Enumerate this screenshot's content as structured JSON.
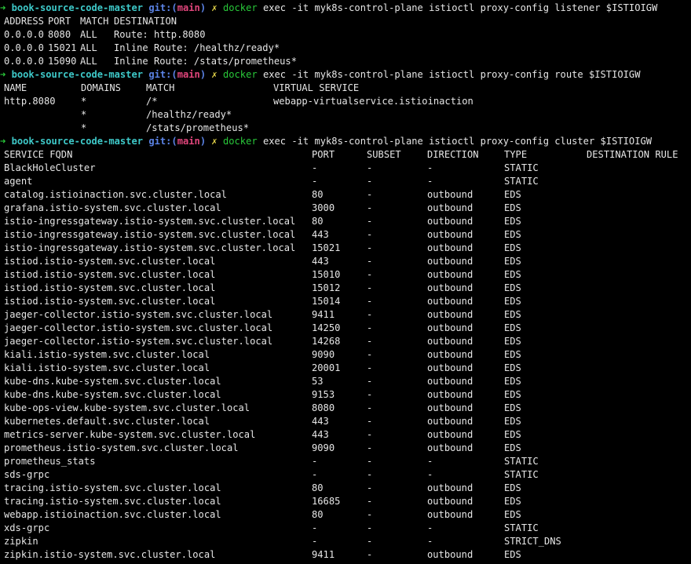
{
  "prompt": {
    "arrow": "➜",
    "dir": "book-source-code-master",
    "git_label": "git:(",
    "branch": "main",
    "git_close": ")",
    "dirty": "✗",
    "cmd": "docker"
  },
  "commands": [
    "exec -it myk8s-control-plane istioctl proxy-config listener $ISTIOIGW",
    "exec -it myk8s-control-plane istioctl proxy-config route $ISTIOIGW",
    "exec -it myk8s-control-plane istioctl proxy-config cluster $ISTIOIGW"
  ],
  "listener": {
    "headers": [
      "ADDRESS",
      "PORT",
      "MATCH",
      "DESTINATION"
    ],
    "rows": [
      [
        "0.0.0.0",
        "8080",
        "ALL",
        "Route: http.8080"
      ],
      [
        "0.0.0.0",
        "15021",
        "ALL",
        "Inline Route: /healthz/ready*"
      ],
      [
        "0.0.0.0",
        "15090",
        "ALL",
        "Inline Route: /stats/prometheus*"
      ]
    ]
  },
  "route": {
    "headers": [
      "NAME",
      "DOMAINS",
      "MATCH",
      "VIRTUAL SERVICE"
    ],
    "rows": [
      [
        "http.8080",
        "*",
        "/*",
        "webapp-virtualservice.istioinaction"
      ],
      [
        "",
        "*",
        "/healthz/ready*",
        ""
      ],
      [
        "",
        "*",
        "/stats/prometheus*",
        ""
      ]
    ]
  },
  "cluster": {
    "headers": [
      "SERVICE FQDN",
      "PORT",
      "SUBSET",
      "DIRECTION",
      "TYPE",
      "DESTINATION RULE"
    ],
    "rows": [
      [
        "BlackHoleCluster",
        "-",
        "-",
        "-",
        "STATIC",
        ""
      ],
      [
        "agent",
        "-",
        "-",
        "-",
        "STATIC",
        ""
      ],
      [
        "catalog.istioinaction.svc.cluster.local",
        "80",
        "-",
        "outbound",
        "EDS",
        ""
      ],
      [
        "grafana.istio-system.svc.cluster.local",
        "3000",
        "-",
        "outbound",
        "EDS",
        ""
      ],
      [
        "istio-ingressgateway.istio-system.svc.cluster.local",
        "80",
        "-",
        "outbound",
        "EDS",
        ""
      ],
      [
        "istio-ingressgateway.istio-system.svc.cluster.local",
        "443",
        "-",
        "outbound",
        "EDS",
        ""
      ],
      [
        "istio-ingressgateway.istio-system.svc.cluster.local",
        "15021",
        "-",
        "outbound",
        "EDS",
        ""
      ],
      [
        "istiod.istio-system.svc.cluster.local",
        "443",
        "-",
        "outbound",
        "EDS",
        ""
      ],
      [
        "istiod.istio-system.svc.cluster.local",
        "15010",
        "-",
        "outbound",
        "EDS",
        ""
      ],
      [
        "istiod.istio-system.svc.cluster.local",
        "15012",
        "-",
        "outbound",
        "EDS",
        ""
      ],
      [
        "istiod.istio-system.svc.cluster.local",
        "15014",
        "-",
        "outbound",
        "EDS",
        ""
      ],
      [
        "jaeger-collector.istio-system.svc.cluster.local",
        "9411",
        "-",
        "outbound",
        "EDS",
        ""
      ],
      [
        "jaeger-collector.istio-system.svc.cluster.local",
        "14250",
        "-",
        "outbound",
        "EDS",
        ""
      ],
      [
        "jaeger-collector.istio-system.svc.cluster.local",
        "14268",
        "-",
        "outbound",
        "EDS",
        ""
      ],
      [
        "kiali.istio-system.svc.cluster.local",
        "9090",
        "-",
        "outbound",
        "EDS",
        ""
      ],
      [
        "kiali.istio-system.svc.cluster.local",
        "20001",
        "-",
        "outbound",
        "EDS",
        ""
      ],
      [
        "kube-dns.kube-system.svc.cluster.local",
        "53",
        "-",
        "outbound",
        "EDS",
        ""
      ],
      [
        "kube-dns.kube-system.svc.cluster.local",
        "9153",
        "-",
        "outbound",
        "EDS",
        ""
      ],
      [
        "kube-ops-view.kube-system.svc.cluster.local",
        "8080",
        "-",
        "outbound",
        "EDS",
        ""
      ],
      [
        "kubernetes.default.svc.cluster.local",
        "443",
        "-",
        "outbound",
        "EDS",
        ""
      ],
      [
        "metrics-server.kube-system.svc.cluster.local",
        "443",
        "-",
        "outbound",
        "EDS",
        ""
      ],
      [
        "prometheus.istio-system.svc.cluster.local",
        "9090",
        "-",
        "outbound",
        "EDS",
        ""
      ],
      [
        "prometheus_stats",
        "-",
        "-",
        "-",
        "STATIC",
        ""
      ],
      [
        "sds-grpc",
        "-",
        "-",
        "-",
        "STATIC",
        ""
      ],
      [
        "tracing.istio-system.svc.cluster.local",
        "80",
        "-",
        "outbound",
        "EDS",
        ""
      ],
      [
        "tracing.istio-system.svc.cluster.local",
        "16685",
        "-",
        "outbound",
        "EDS",
        ""
      ],
      [
        "webapp.istioinaction.svc.cluster.local",
        "80",
        "-",
        "outbound",
        "EDS",
        ""
      ],
      [
        "xds-grpc",
        "-",
        "-",
        "-",
        "STATIC",
        ""
      ],
      [
        "zipkin",
        "-",
        "-",
        "-",
        "STRICT_DNS",
        ""
      ],
      [
        "zipkin.istio-system.svc.cluster.local",
        "9411",
        "-",
        "outbound",
        "EDS",
        ""
      ]
    ]
  },
  "colors": {
    "background": "#000000",
    "text": "#e6e6e6",
    "arrow": "#29c93a",
    "dir": "#3ec9c9",
    "git": "#5b83e6",
    "branch": "#e0457b",
    "dirty": "#e6d64a",
    "command": "#29c93a"
  }
}
